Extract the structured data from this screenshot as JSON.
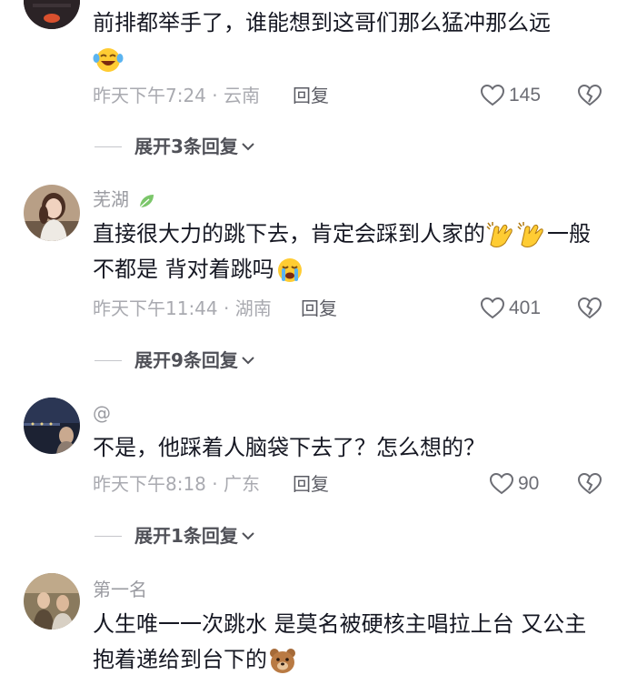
{
  "icons": {
    "like": "heart-outline-icon",
    "dislike": "broken-heart-icon",
    "expand": "chevron-down-icon",
    "badge": "leaf-icon"
  },
  "colors": {
    "text": "#161823",
    "meta": "#a9aab0",
    "username": "#9a9ba1",
    "icon": "#6c6d74"
  },
  "comments": [
    {
      "username": "",
      "text": "前排都举手了，谁能想到这哥们那么猛冲那么远",
      "emoji": [
        "laughing-tears-emoji"
      ],
      "meta": "昨天下午7:24 · 云南",
      "reply": "回复",
      "likes": "145",
      "expand": "展开3条回复"
    },
    {
      "username": "芜湖",
      "text_a": "直接很大力的跳下去，肯定会踩到人家的",
      "text_b": "一般不都是 背对着跳吗",
      "emoji": [
        "clapping-hands-emoji",
        "clapping-hands-emoji",
        "crying-emoji"
      ],
      "meta": "昨天下午11:44 · 湖南",
      "reply": "回复",
      "likes": "401",
      "expand": "展开9条回复"
    },
    {
      "username": "@",
      "text": "不是，他踩着人脑袋下去了？怎么想的？",
      "meta": "昨天下午8:18 · 广东",
      "reply": "回复",
      "likes": "90",
      "expand": "展开1条回复"
    },
    {
      "username": "第一名",
      "text": "人生唯一一次跳水 是莫名被硬核主唱拉上台 又公主抱着递给到台下的",
      "emoji": [
        "bear-emoji"
      ]
    }
  ]
}
